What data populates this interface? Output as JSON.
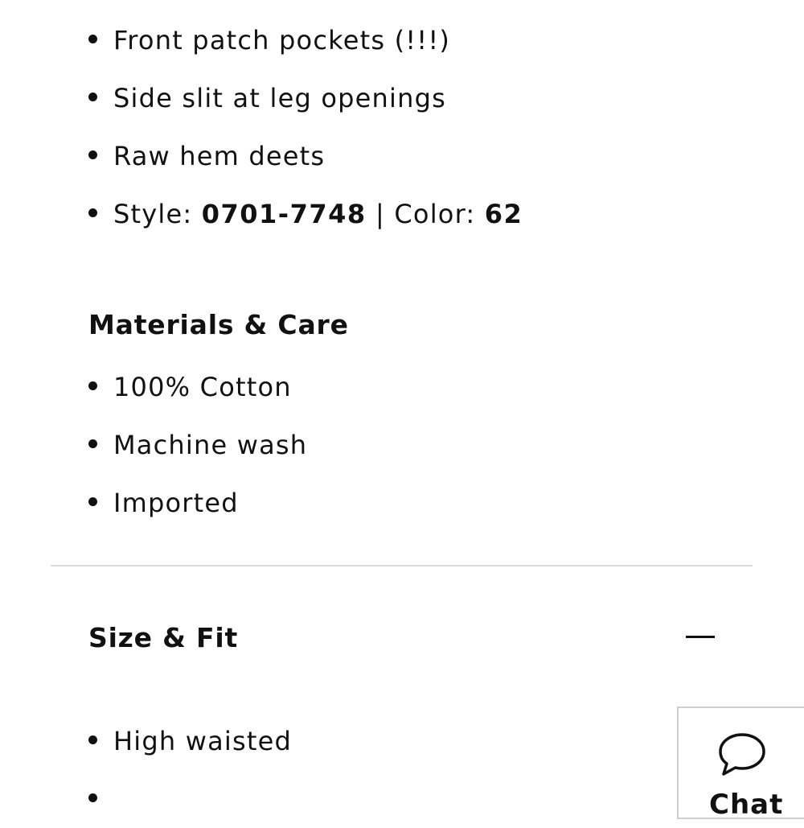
{
  "features": [
    "Front patch pockets (!!!)",
    "Side slit at leg openings",
    "Raw hem deets"
  ],
  "style_line": {
    "style_label": "Style: ",
    "style_value": "0701-7748",
    "separator": " | ",
    "color_label": "Color: ",
    "color_value": "62"
  },
  "materials_care": {
    "heading": "Materials & Care",
    "items": [
      "100% Cotton",
      "Machine wash",
      "Imported"
    ]
  },
  "size_fit": {
    "heading": "Size & Fit",
    "toggle_icon": "minus-icon",
    "items": [
      "High waisted",
      ""
    ]
  },
  "chat": {
    "label": "Chat",
    "icon": "chat-bubble-icon"
  },
  "colors": {
    "text": "#111111",
    "divider": "#d8d8d8",
    "chat_border": "#cfcfcf",
    "background": "#ffffff"
  }
}
